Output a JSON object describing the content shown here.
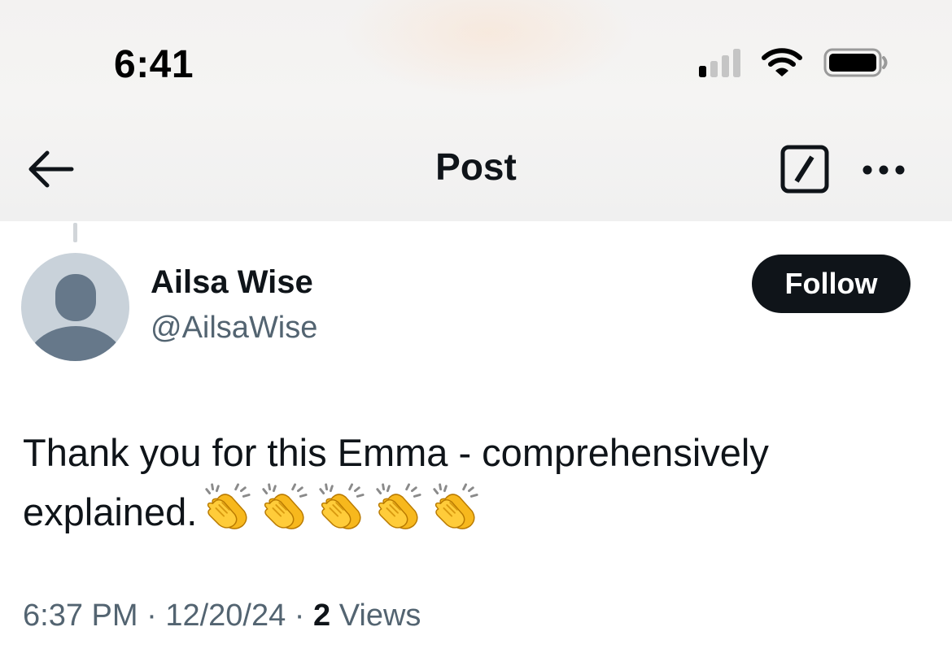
{
  "status_bar": {
    "time": "6:41"
  },
  "header": {
    "title": "Post"
  },
  "post": {
    "author_name": "Ailsa Wise",
    "author_handle": "@AilsaWise",
    "follow_label": "Follow",
    "text_line1": "Thank you for this Emma - comprehensively",
    "text_line2": "explained.",
    "emoji": [
      "clapping-hands",
      "clapping-hands",
      "clapping-hands",
      "clapping-hands",
      "clapping-hands"
    ],
    "time": "6:37 PM",
    "date": "12/20/24",
    "separator": "·",
    "views_count": "2",
    "views_label": "Views"
  },
  "colors": {
    "text_primary": "#0f1419",
    "text_secondary": "#536471",
    "follow_button_bg": "#0f1419",
    "avatar_bg": "#c9d2da",
    "avatar_figure": "#66788a"
  },
  "icons": [
    "cellular-signal-icon",
    "wifi-icon",
    "battery-icon",
    "back-arrow-icon",
    "grok-icon",
    "more-icon",
    "clapping-hands-icon"
  ]
}
